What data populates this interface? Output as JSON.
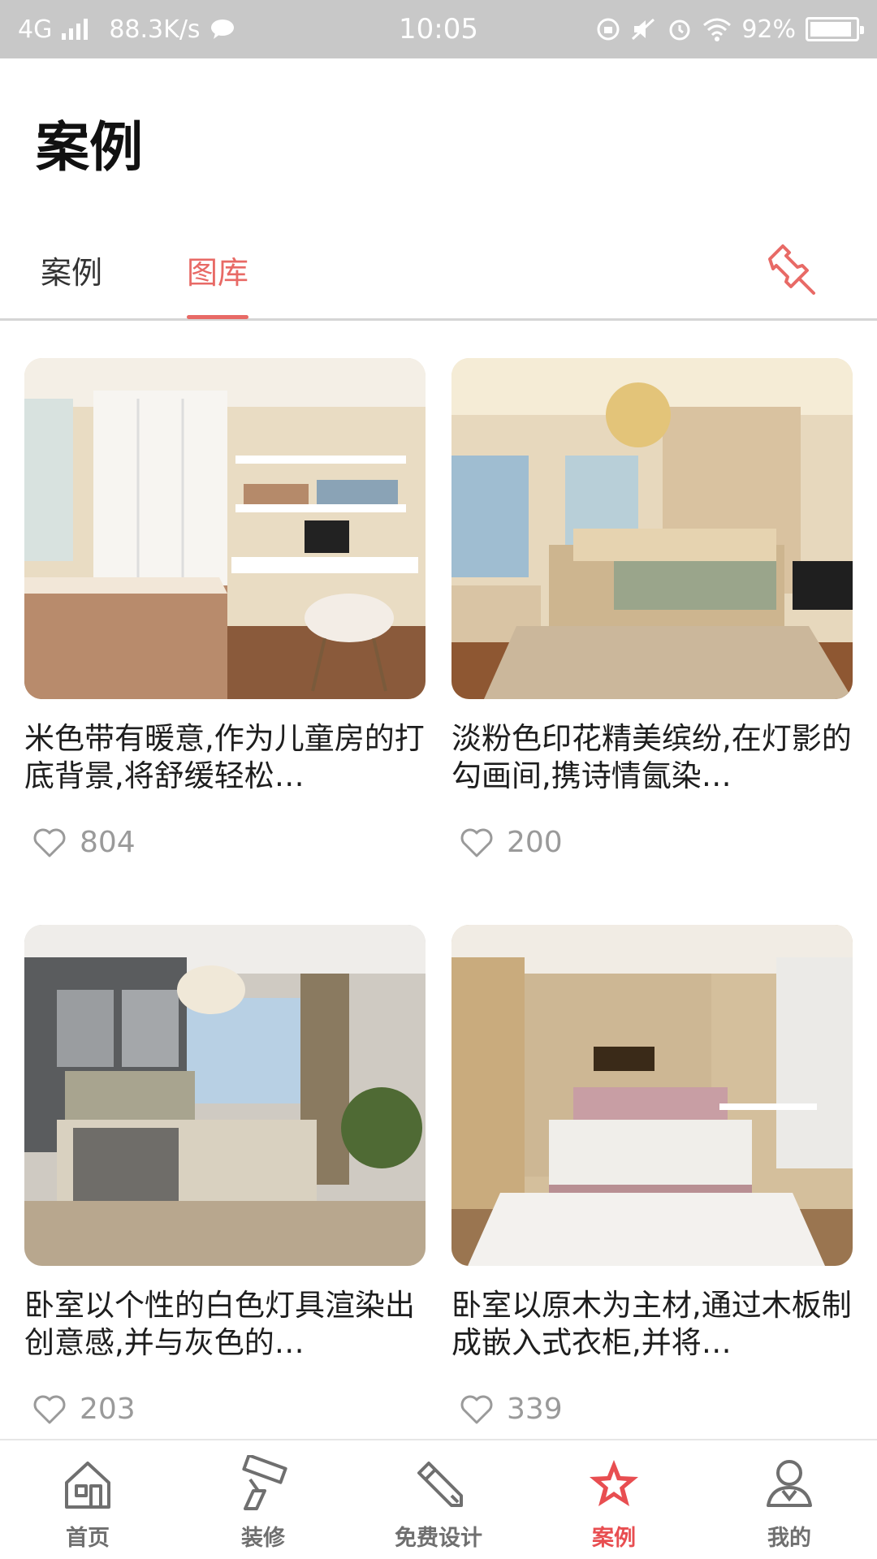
{
  "status_bar": {
    "network": "4G",
    "speed": "88.3K/s",
    "time": "10:05",
    "battery": "92%",
    "battery_level": 0.92
  },
  "header": {
    "title": "案例"
  },
  "tabs": [
    {
      "label": "案例",
      "active": false
    },
    {
      "label": "图库",
      "active": true
    }
  ],
  "accent_color": "#e86a66",
  "gallery": [
    {
      "title": "米色带有暖意,作为儿童房的打底背景,将舒缓轻松…",
      "likes": "804"
    },
    {
      "title": "淡粉色印花精美缤纷,在灯影的勾画间,携诗情氤染…",
      "likes": "200"
    },
    {
      "title": "卧室以个性的白色灯具渲染出创意感,并与灰色的…",
      "likes": "203"
    },
    {
      "title": "卧室以原木为主材,通过木板制成嵌入式衣柜,并将…",
      "likes": "339"
    }
  ],
  "bottom_nav": [
    {
      "label": "首页",
      "icon": "home-icon",
      "active": false
    },
    {
      "label": "装修",
      "icon": "paint-roller-icon",
      "active": false
    },
    {
      "label": "免费设计",
      "icon": "pencil-icon",
      "active": false
    },
    {
      "label": "案例",
      "icon": "star-icon",
      "active": true
    },
    {
      "label": "我的",
      "icon": "user-icon",
      "active": false
    }
  ]
}
